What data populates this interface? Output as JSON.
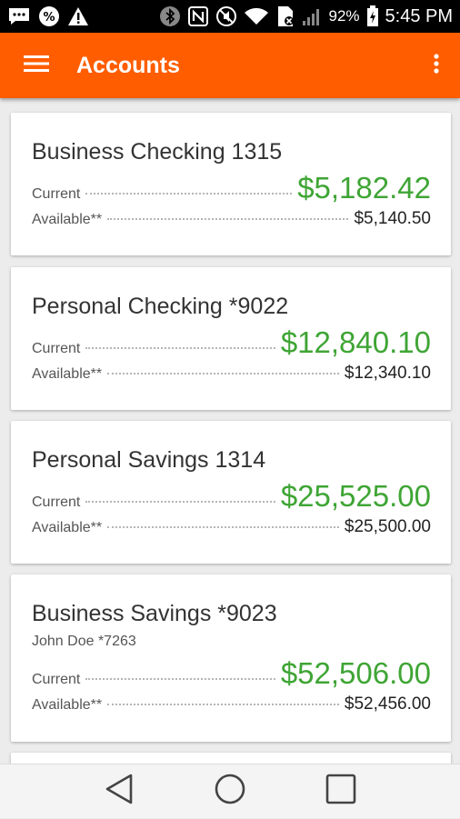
{
  "status_bar": {
    "icons": [
      "message-icon",
      "percent-icon",
      "warning-icon",
      "bluetooth-icon",
      "nfc-icon",
      "mute-icon",
      "wifi-icon",
      "no-sim-icon",
      "signal-icon",
      "battery-icon"
    ],
    "battery": "92%",
    "time": "5:45 PM"
  },
  "app_bar": {
    "title": "Accounts",
    "background": "#ff5d00"
  },
  "accounts": [
    {
      "name": "Business Checking 1315",
      "current_label": "Current",
      "current": "$5,182.42",
      "available_label": "Available**",
      "available": "$5,140.50"
    },
    {
      "name": "Personal Checking *9022",
      "current_label": "Current",
      "current": "$12,840.10",
      "available_label": "Available**",
      "available": "$12,340.10"
    },
    {
      "name": "Personal Savings 1314",
      "current_label": "Current",
      "current": "$25,525.00",
      "available_label": "Available**",
      "available": "$25,500.00"
    },
    {
      "name": "Business Savings *9023",
      "owner": "John Doe *7263",
      "current_label": "Current",
      "current": "$52,506.00",
      "available_label": "Available**",
      "available": "$52,456.00"
    }
  ],
  "colors": {
    "accent": "#ff5d00",
    "amount_green": "#3fa535"
  },
  "nav_bar": {
    "buttons": [
      "back-icon",
      "home-icon",
      "recents-icon"
    ]
  }
}
